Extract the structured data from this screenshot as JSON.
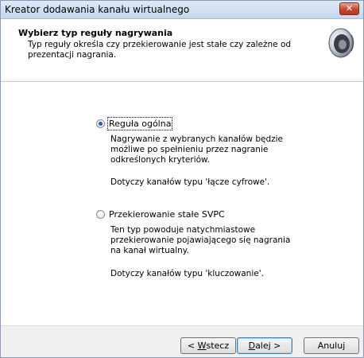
{
  "window": {
    "title": "Kreator dodawania kanału wirtualnego",
    "close_glyph": "✕"
  },
  "header": {
    "title": "Wybierz typ reguły nagrywania",
    "description": "Typ reguły określa czy przekierowanie jest stałe czy zależne od prezentacji nagrania.",
    "icon": "speaker-icon"
  },
  "options": [
    {
      "label": "Reguła ogólna",
      "selected": true,
      "desc1": "Nagrywanie z wybranych kanałów będzie możliwe po spełnieniu przez nagranie odkreślonych kryteriów.",
      "desc2": "Dotyczy kanałów typu 'łącze cyfrowe'."
    },
    {
      "label": "Przekierowanie stałe SVPC",
      "selected": false,
      "desc1": "Ten typ powoduje natychmiastowe przekierowanie pojawiającego się nagrania na kanał wirtualny.",
      "desc2": "Dotyczy kanałów typu 'kluczowanie'."
    }
  ],
  "buttons": {
    "back_prefix": "< ",
    "back_mnemonic": "W",
    "back_rest": "stecz",
    "next_mnemonic": "D",
    "next_rest": "alej >",
    "cancel": "Anuluj"
  }
}
